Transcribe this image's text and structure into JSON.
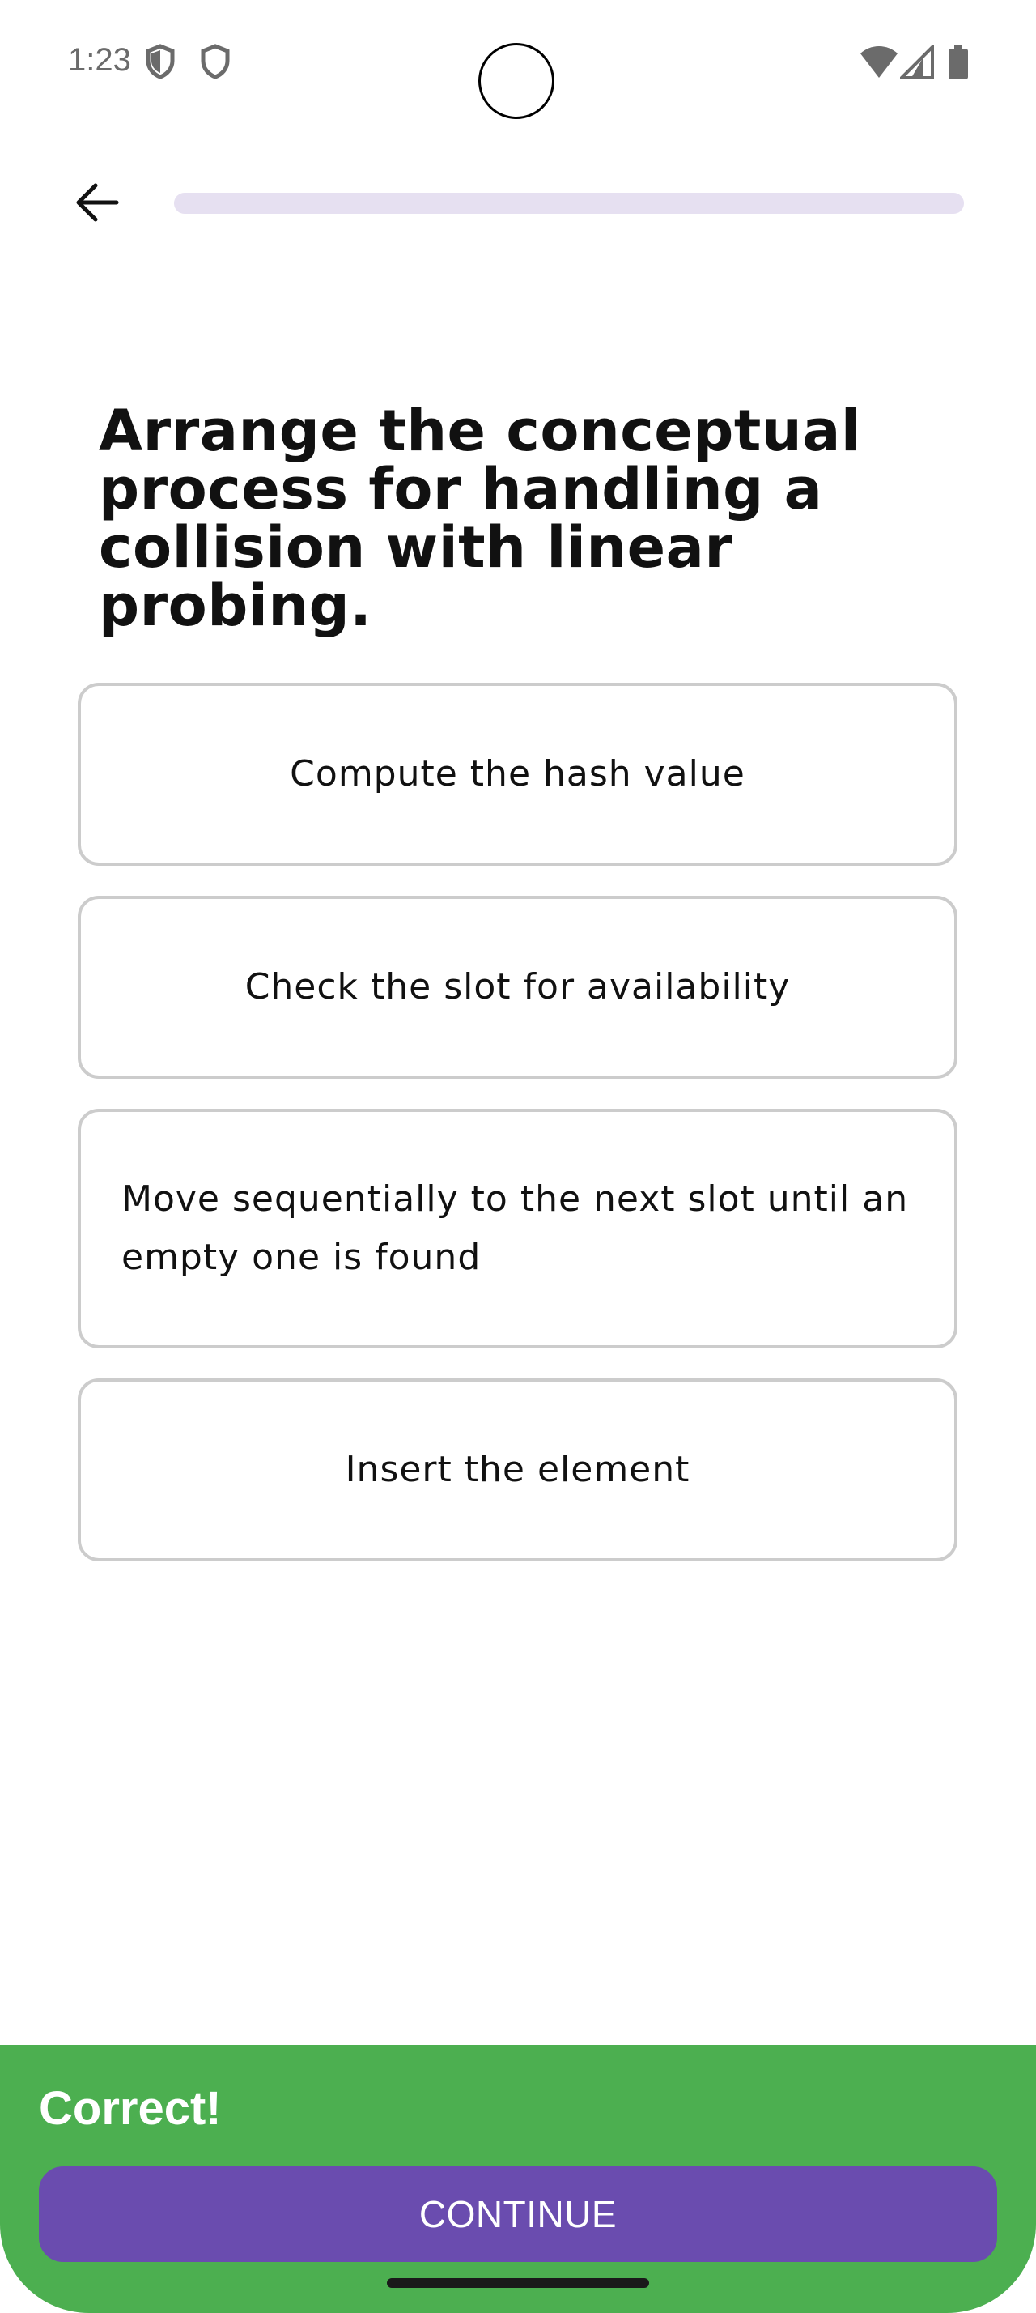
{
  "status_bar": {
    "time": "1:23",
    "icons": [
      "shield-icon",
      "shield-icon",
      "wifi-icon",
      "cellular-signal-icon",
      "battery-icon"
    ]
  },
  "top_bar": {
    "back_icon": "arrow-left-icon",
    "progress_fraction": 0.0
  },
  "question": {
    "text": "Arrange the conceptual process for handling a collision with linear probing."
  },
  "options": [
    {
      "label": "Compute the hash value"
    },
    {
      "label": "Check the slot for availability"
    },
    {
      "label": "Move sequentially to the next slot until an empty one is found"
    },
    {
      "label": "Insert the element"
    }
  ],
  "feedback": {
    "title": "Correct!",
    "continue_label": "CONTINUE"
  },
  "colors": {
    "feedback_green": "#4caf50",
    "primary_purple": "#6a4caf",
    "progress_track": "#e6e0f1",
    "option_border": "#cccccc"
  }
}
